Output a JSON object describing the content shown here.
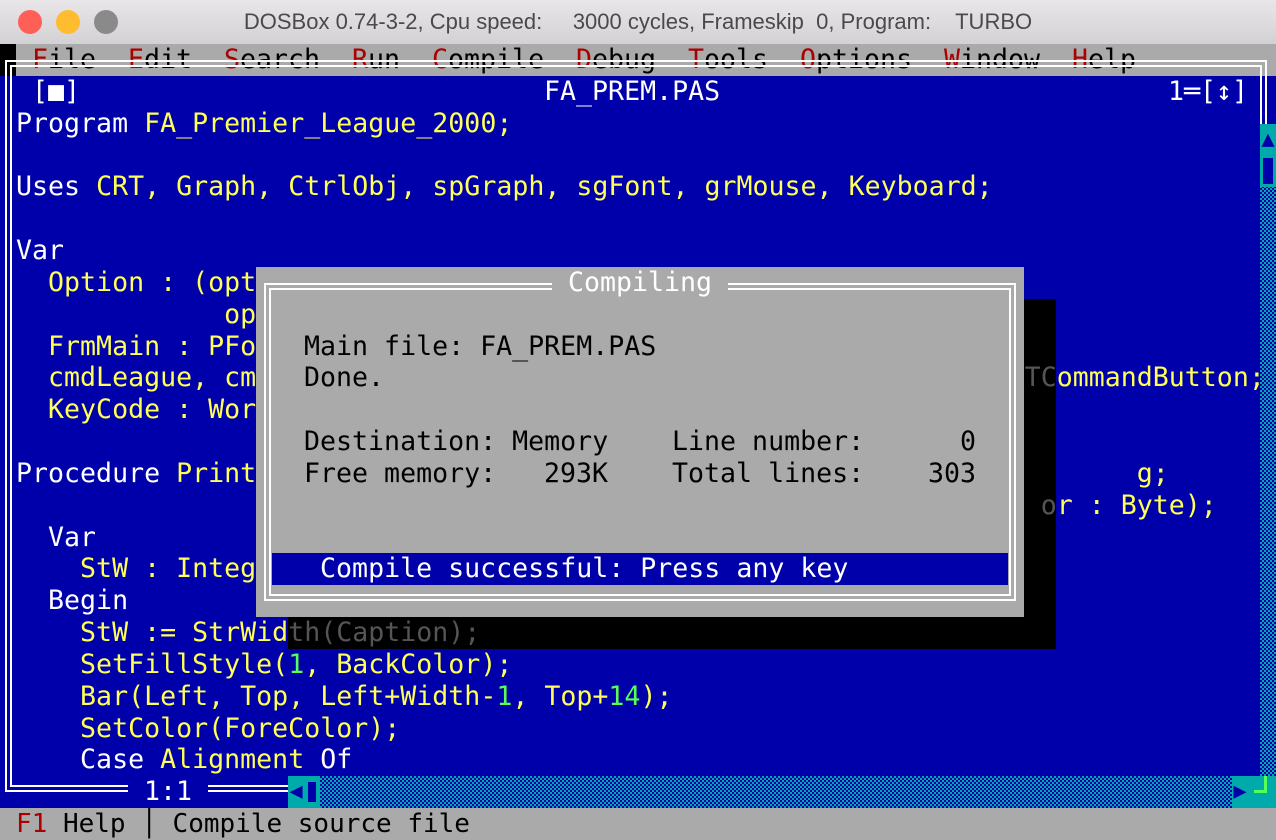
{
  "window": {
    "title": "DOSBox 0.74-3-2, Cpu speed:     3000 cycles, Frameskip  0, Program:    TURBO",
    "lights": [
      "#fe5f57",
      "#febc2e",
      "#8a8a8a"
    ]
  },
  "menu": [
    {
      "hot": "F",
      "rest": "ile"
    },
    {
      "hot": "E",
      "rest": "dit"
    },
    {
      "hot": "S",
      "rest": "earch"
    },
    {
      "hot": "R",
      "rest": "un"
    },
    {
      "hot": "C",
      "rest": "ompile"
    },
    {
      "hot": "D",
      "rest": "ebug"
    },
    {
      "hot": "T",
      "rest": "ools"
    },
    {
      "hot": "O",
      "rest": "ptions"
    },
    {
      "hot": "W",
      "rest": "indow"
    },
    {
      "hot": "H",
      "rest": "elp"
    }
  ],
  "editor": {
    "close_box": "[■]",
    "filename": " FA_PREM.PAS ",
    "window_number": "1═[↕]",
    "cursor_pos": " 1:1 ",
    "lines": [
      [
        {
          "t": "Program ",
          "c": "kw"
        },
        {
          "t": "FA_Premier_League_2000;",
          "c": "id"
        }
      ],
      [],
      [
        {
          "t": "Uses ",
          "c": "kw"
        },
        {
          "t": "CRT, Graph, CtrlObj, spGraph, sgFont, grMouse, Keyboard;",
          "c": "id"
        }
      ],
      [],
      [
        {
          "t": "Var",
          "c": "kw"
        }
      ],
      [
        {
          "t": "  Option : (opt",
          "c": "id"
        }
      ],
      [
        {
          "t": "             opt",
          "c": "id"
        }
      ],
      [
        {
          "t": "  FrmMain : PFo",
          "c": "id"
        }
      ],
      [
        {
          "t": "  cmdLeague, cm                                                TCommandButton;",
          "c": "id"
        }
      ],
      [
        {
          "t": "  KeyCode : Wor",
          "c": "id"
        }
      ],
      [],
      [
        {
          "t": "Procedure ",
          "c": "kw"
        },
        {
          "t": "Print                                                       g;",
          "c": "id"
        }
      ],
      [
        {
          "t": "                                                                or : Byte);",
          "c": "id"
        }
      ],
      [
        {
          "t": "  Var",
          "c": "kw"
        }
      ],
      [
        {
          "t": "    StW : Integ",
          "c": "id"
        }
      ],
      [
        {
          "t": "  Begin",
          "c": "kw"
        }
      ],
      [
        {
          "t": "    StW := StrWidth(Caption);",
          "c": "id"
        }
      ],
      [
        {
          "t": "    SetFillStyle(",
          "c": "id"
        },
        {
          "t": "1",
          "c": "num"
        },
        {
          "t": ", BackColor);",
          "c": "id"
        }
      ],
      [
        {
          "t": "    Bar(Left, Top, Left+Width-",
          "c": "id"
        },
        {
          "t": "1",
          "c": "num"
        },
        {
          "t": ", Top+",
          "c": "id"
        },
        {
          "t": "14",
          "c": "num"
        },
        {
          "t": ");",
          "c": "id"
        }
      ],
      [
        {
          "t": "    SetColor(ForeColor);",
          "c": "id"
        }
      ],
      [
        {
          "t": "    Case ",
          "c": "kw"
        },
        {
          "t": "Alignment",
          "c": "id"
        },
        {
          "t": " Of",
          "c": "kw"
        }
      ]
    ]
  },
  "dialog": {
    "title": " Compiling ",
    "main_file_label": "Main file: ",
    "main_file": "FA_PREM.PAS",
    "done": "Done.",
    "destination_label": "Destination: ",
    "destination": "Memory",
    "free_memory_label": "Free memory:",
    "free_memory": "293K",
    "line_number_label": "Line number:",
    "line_number": "0",
    "total_lines_label": "Total lines:",
    "total_lines": "303",
    "status": "   Compile successful: Press any key"
  },
  "statusbar": {
    "key": "F1",
    "key_label": " Help ",
    "separator": "│",
    "hint": " Compile source file"
  },
  "colors": {
    "background": "#0000aa",
    "keyword": "#ffffff",
    "identifier": "#ffff55",
    "number": "#55ff55",
    "dialog": "#aaaaaa",
    "hotkey": "#aa0000",
    "scrollbar": "#00aaaa"
  }
}
